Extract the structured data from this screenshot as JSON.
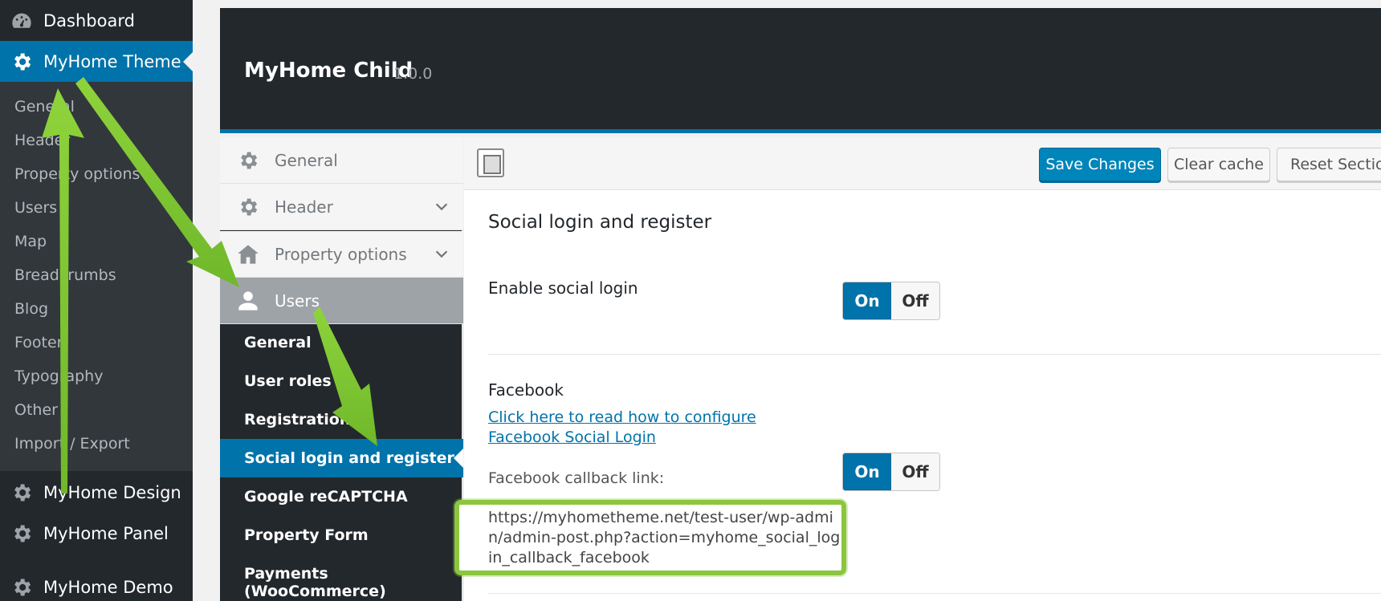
{
  "wp_menu": {
    "dashboard": "Dashboard",
    "myhome_theme": "MyHome Theme",
    "submenu": [
      "General",
      "Header",
      "Property options",
      "Users",
      "Map",
      "Breadcrumbs",
      "Blog",
      "Footer",
      "Typography",
      "Other",
      "Import / Export"
    ],
    "myhome_design": "MyHome Design",
    "myhome_panel": "MyHome Panel",
    "myhome_demo": "MyHome Demo"
  },
  "panel": {
    "title": "MyHome Child",
    "version": "1.0.0"
  },
  "options_nav": {
    "sections": [
      {
        "label": "General",
        "icon": "gear-icon"
      },
      {
        "label": "Header",
        "icon": "gear-icon"
      },
      {
        "label": "Property options",
        "icon": "home-icon"
      },
      {
        "label": "Users",
        "icon": "user-icon"
      }
    ],
    "users_sub": [
      "General",
      "User roles",
      "Registration",
      "Social login and register",
      "Google reCAPTCHA",
      "Property Form",
      "Payments (WooCommerce)"
    ]
  },
  "toolbar": {
    "save": "Save Changes",
    "clear": "Clear cache",
    "reset": "Reset Section"
  },
  "content": {
    "section_title": "Social login and register",
    "enable_label": "Enable social login",
    "facebook_label": "Facebook",
    "facebook_link": "Click here to read how to configure Facebook Social Login",
    "callback_label": "Facebook callback link:",
    "callback_url": "https://myhometheme.net/test-user/wp-admin/admin-post.php?action=myhome_social_login_callback_facebook",
    "toggle_on": "On",
    "toggle_off": "Off"
  },
  "colors": {
    "accent": "#0073aa",
    "sidebar": "#23282d",
    "highlight": "#8cc63f"
  }
}
